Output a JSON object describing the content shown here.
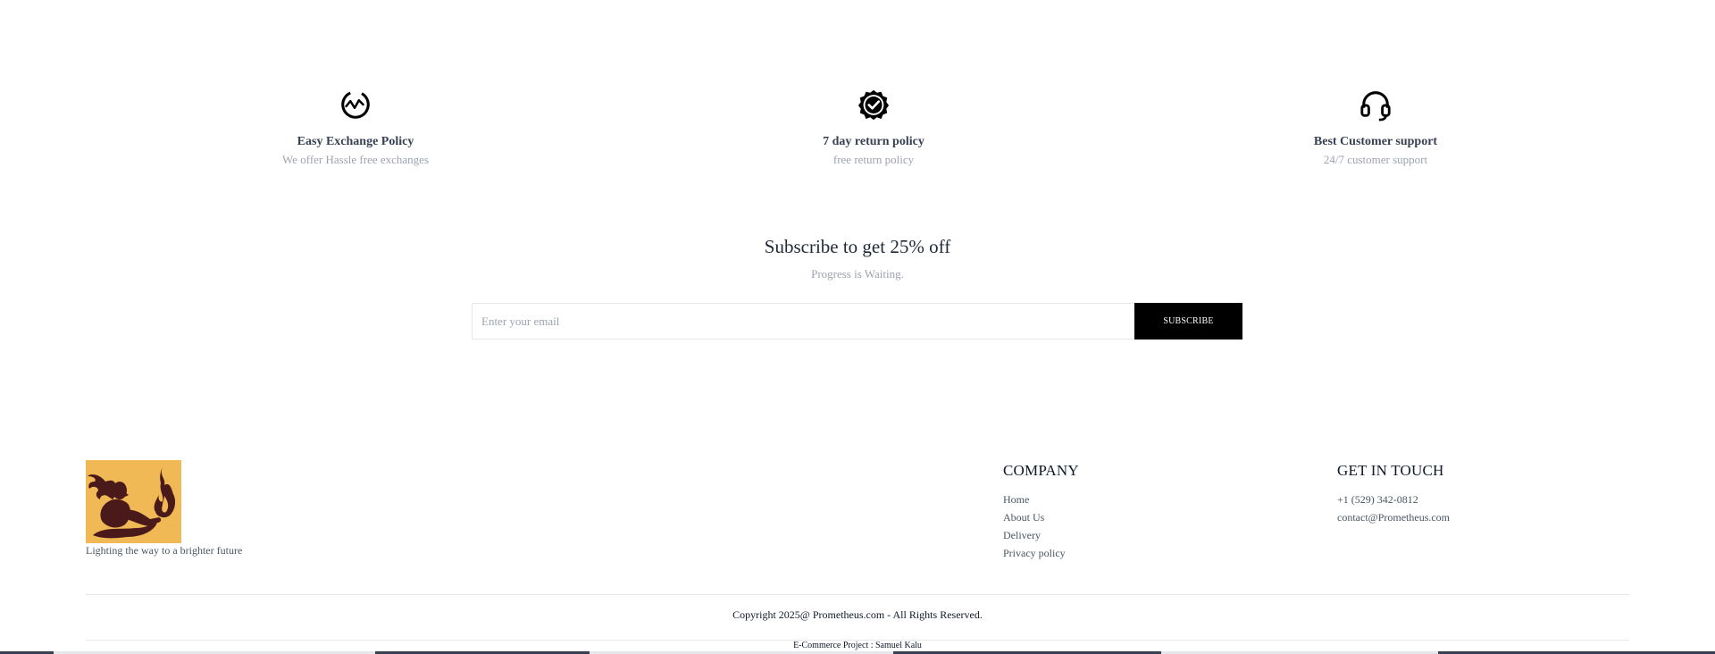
{
  "features": [
    {
      "icon": "exchange-icon",
      "title": "Easy Exchange Policy",
      "desc": "We offer Hassle free exchanges"
    },
    {
      "icon": "quality-check-icon",
      "title": "7 day return policy",
      "desc": "free return policy"
    },
    {
      "icon": "headset-icon",
      "title": "Best Customer support",
      "desc": "24/7 customer support"
    }
  ],
  "subscribe": {
    "heading": "Subscribe to get 25% off",
    "subtitle": "Progress is Waiting.",
    "placeholder": "Enter your email",
    "button_label": "SUBSCRIBE"
  },
  "footer": {
    "tagline": "Lighting the way to a brighter future",
    "logo_icon": "prometheus-logo",
    "company": {
      "title": "COMPANY",
      "links": [
        "Home",
        "About Us",
        "Delivery",
        "Privacy policy"
      ]
    },
    "contact": {
      "title": "GET IN TOUCH",
      "phone": "+1 (529) 342-0812",
      "email": "contact@Prometheus.com"
    },
    "copyright": "Copyright 2025@ Prometheus.com - All Rights Reserved.",
    "credit": "E-Commerce Project : Samuel Kalu"
  },
  "colors": {
    "accent": "#000000",
    "logo_bg": "#F0B955",
    "logo_fg": "#4A1A1B"
  }
}
